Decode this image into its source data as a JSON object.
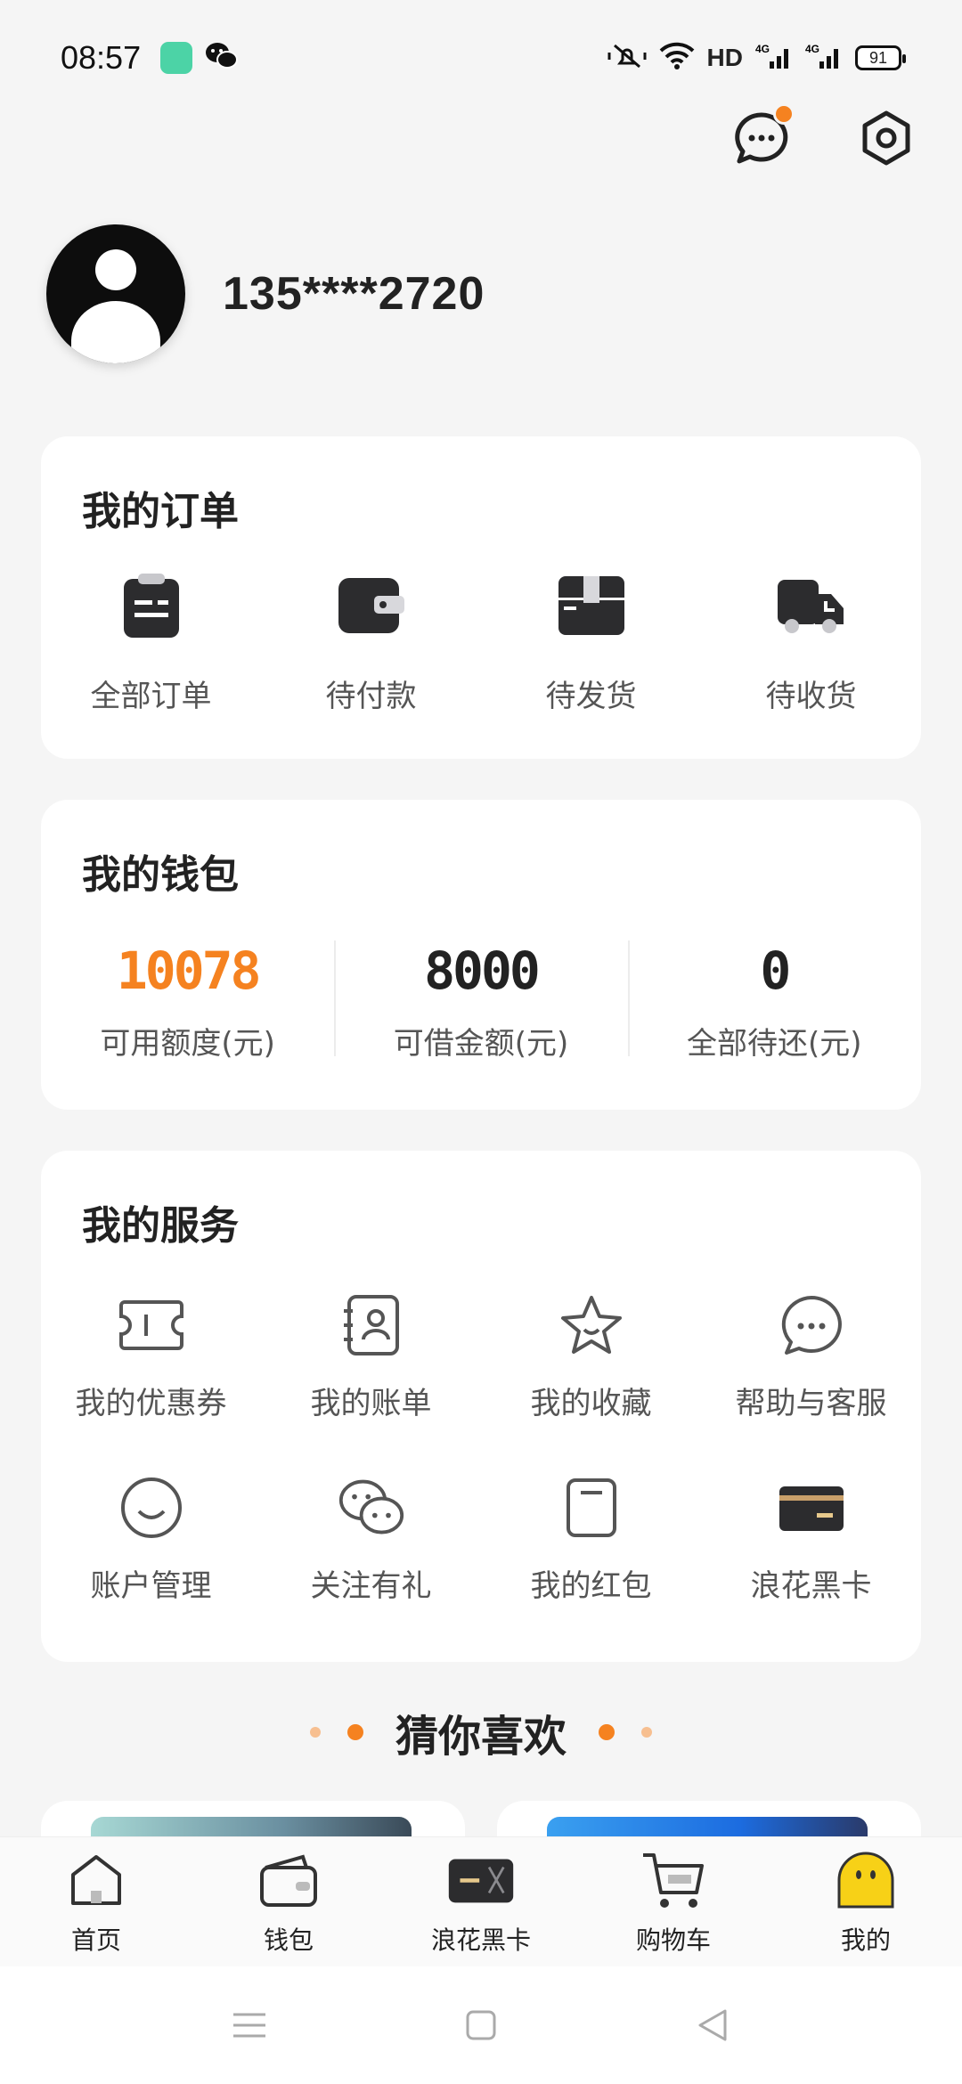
{
  "status_bar": {
    "time": "08:57",
    "network_label": "HD",
    "battery": "91",
    "colors": {
      "app_icon": "#4cd3a6"
    }
  },
  "header": {
    "phone": "135****2720",
    "message_badge_color": "#f58220"
  },
  "orders": {
    "title": "我的订单",
    "items": [
      {
        "label": "全部订单",
        "icon": "clipboard-icon"
      },
      {
        "label": "待付款",
        "icon": "wallet-icon"
      },
      {
        "label": "待发货",
        "icon": "box-icon"
      },
      {
        "label": "待收货",
        "icon": "truck-icon"
      }
    ]
  },
  "wallet": {
    "title": "我的钱包",
    "items": [
      {
        "value": "10078",
        "label": "可用额度(元)",
        "color": "#f58220"
      },
      {
        "value": "8000",
        "label": "可借金额(元)",
        "color": "#222222"
      },
      {
        "value": "0",
        "label": "全部待还(元)",
        "color": "#222222"
      }
    ]
  },
  "services": {
    "title": "我的服务",
    "items": [
      {
        "label": "我的优惠券",
        "icon": "coupon-icon"
      },
      {
        "label": "我的账单",
        "icon": "bill-icon"
      },
      {
        "label": "我的收藏",
        "icon": "star-icon"
      },
      {
        "label": "帮助与客服",
        "icon": "chat-icon"
      },
      {
        "label": "账户管理",
        "icon": "smile-icon"
      },
      {
        "label": "关注有礼",
        "icon": "wechat-icon"
      },
      {
        "label": "我的红包",
        "icon": "red-envelope-icon"
      },
      {
        "label": "浪花黑卡",
        "icon": "black-card-icon"
      }
    ]
  },
  "guess": {
    "title": "猜你喜欢"
  },
  "tabbar": {
    "items": [
      {
        "label": "首页",
        "icon": "home-icon"
      },
      {
        "label": "钱包",
        "icon": "wallet-icon"
      },
      {
        "label": "浪花黑卡",
        "icon": "black-card-icon"
      },
      {
        "label": "购物车",
        "icon": "cart-icon"
      },
      {
        "label": "我的",
        "icon": "profile-icon"
      }
    ]
  }
}
